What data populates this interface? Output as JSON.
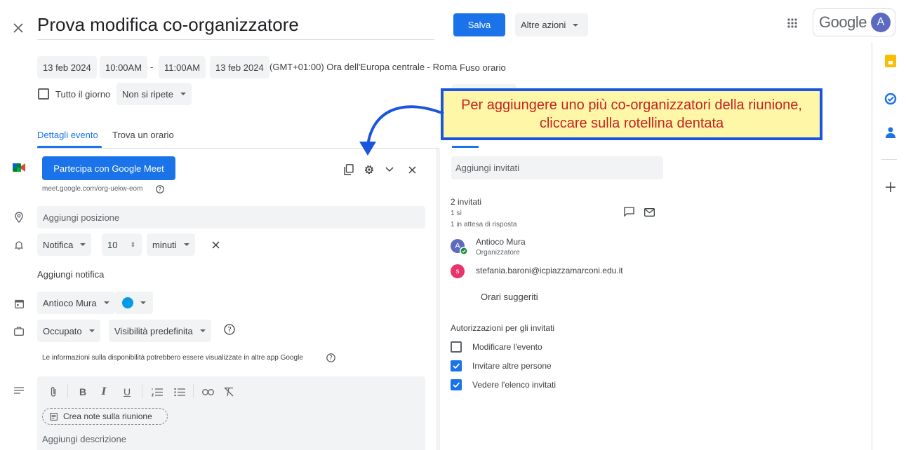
{
  "header": {
    "title": "Prova modifica co-organizzatore",
    "save_label": "Salva",
    "more_actions_label": "Altre azioni",
    "logo": "Google",
    "avatar_letter": "A"
  },
  "datetime": {
    "start_date": "13 feb 2024",
    "start_time": "10:00AM",
    "separator": "-",
    "end_time": "11:00AM",
    "end_date": "13 feb 2024",
    "timezone_text": "(GMT+01:00) Ora dell'Europa centrale - Roma",
    "timezone_link": "Fuso orario",
    "all_day_label": "Tutto il giorno",
    "repeat_label": "Non si ripete"
  },
  "tabs": {
    "details": "Dettagli evento",
    "find_time": "Trova un orario"
  },
  "callout": {
    "text": "Per aggiungere uno più co-organizzatori della riunione, cliccare sulla rotellina dentata"
  },
  "meet": {
    "join_label": "Partecipa con Google Meet",
    "link": "meet.google.com/org-uekw-eom"
  },
  "location": {
    "placeholder": "Aggiungi posizione"
  },
  "notification": {
    "type": "Notifica",
    "value": "10",
    "unit": "minuti",
    "add_label": "Aggiungi notifica"
  },
  "calendar": {
    "owner": "Antioco Mura",
    "color": "#039be5"
  },
  "availability": {
    "status": "Occupato",
    "visibility": "Visibilità predefinita",
    "info": "Le informazioni sulla disponibilità potrebbero essere visualizzate in altre app Google"
  },
  "description": {
    "notes_label": "Crea note sulla riunione",
    "placeholder": "Aggiungi descrizione"
  },
  "guests": {
    "add_placeholder": "Aggiungi invitati",
    "count": "2 invitati",
    "yes": "1 sì",
    "pending": "1 in attesa di risposta",
    "list": [
      {
        "avatar": "A",
        "name": "Antioco Mura",
        "role": "Organizzatore",
        "color": "#5c6bc0"
      },
      {
        "avatar": "S",
        "name": "stefania.baroni@icpiazzamarconi.edu.it",
        "role": "",
        "color": "#e8336d"
      }
    ],
    "suggested_times": "Orari suggeriti",
    "permissions_title": "Autorizzazioni per gli invitati",
    "permissions": [
      {
        "label": "Modificare l'evento",
        "checked": false
      },
      {
        "label": "Invitare altre persone",
        "checked": true
      },
      {
        "label": "Vedere l'elenco invitati",
        "checked": true
      }
    ]
  },
  "colors": {
    "accent": "#1a73e8",
    "callout_bg": "#fff7a8",
    "callout_border": "#1a55e0",
    "callout_text": "#c5221f"
  }
}
